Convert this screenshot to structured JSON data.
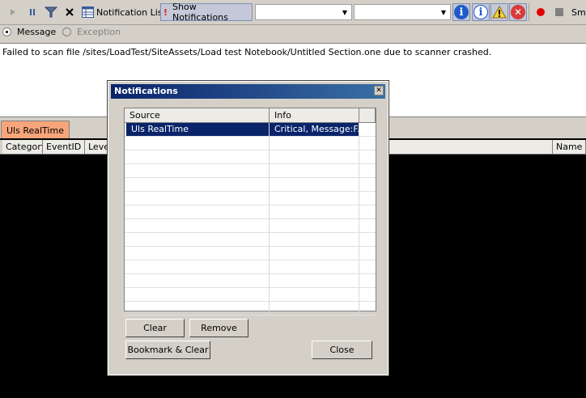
{
  "toolbar": {
    "notification_list_label": "Notification List",
    "show_notifications_label": "Show Notifications",
    "combo1_value": "",
    "combo2_value": "",
    "smart_label": "Sma"
  },
  "radio": {
    "message_label": "Message",
    "exception_label": "Exception"
  },
  "message": {
    "text": "Failed to scan file /sites/LoadTest/SiteAssets/Load test Notebook/Untitled Section.one due to scanner crashed."
  },
  "tabs": [
    {
      "label": "Uls RealTime"
    }
  ],
  "grid": {
    "columns": [
      "Category",
      "EventID",
      "Level",
      "Name"
    ]
  },
  "dialog": {
    "title": "Notifications",
    "columns": [
      "Source",
      "Info"
    ],
    "rows": [
      {
        "source": "Uls RealTime",
        "info": "Critical, Message:F..."
      }
    ],
    "clear_label": "Clear",
    "remove_label": "Remove",
    "bookmark_clear_label": "Bookmark & Clear",
    "close_label": "Close"
  },
  "colors": {
    "tab_accent": "#f7a57a",
    "selection": "#0a246a",
    "title_bar": "#0a246a"
  }
}
